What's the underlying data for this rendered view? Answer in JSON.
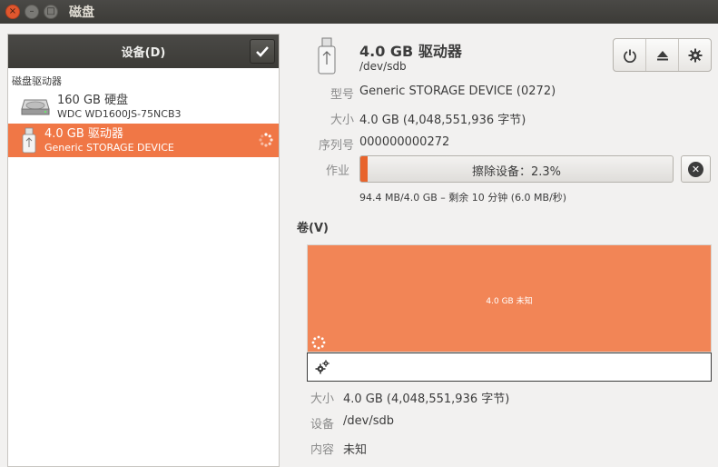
{
  "window": {
    "title": "磁盘",
    "close_glyph": "×",
    "min_glyph": "–",
    "max_glyph": "□"
  },
  "sidebar": {
    "header_title": "设备(D)",
    "section_label": "磁盘驱动器",
    "items": [
      {
        "name": "160 GB 硬盘",
        "subtitle": "WDC WD1600JS-75NCB3",
        "selected": false
      },
      {
        "name": "4.0 GB 驱动器",
        "subtitle": "Generic STORAGE DEVICE",
        "selected": true
      }
    ]
  },
  "device": {
    "title": "4.0 GB 驱动器",
    "path": "/dev/sdb",
    "properties": {
      "model_label": "型号",
      "model_value": "Generic STORAGE DEVICE (0272)",
      "size_label": "大小",
      "size_value": "4.0 GB (4,048,551,936 字节)",
      "serial_label": "序列号",
      "serial_value": "000000000272",
      "job_label": "作业"
    },
    "job": {
      "progress_text": "擦除设备：2.3%",
      "progress_fraction": 0.023,
      "rate_text": "94.4 MB/4.0 GB – 剩余 10 分钟 (6.0 MB/秒)"
    }
  },
  "volumes": {
    "label": "卷(V)",
    "block_text": "4.0 GB 未知",
    "size_label": "大小",
    "size_value": "4.0 GB (4,048,551,936 字节)",
    "device_label": "设备",
    "device_value": "/dev/sdb",
    "contents_label": "内容",
    "contents_value": "未知"
  },
  "colors": {
    "accent": "#f07746",
    "progress": "#e8642c",
    "volume": "#f28556"
  }
}
